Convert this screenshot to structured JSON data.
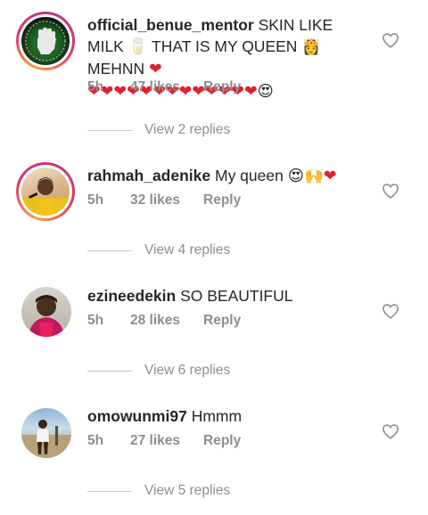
{
  "comments": [
    {
      "username": "official_benue_mentor",
      "text_part1": " SKIN LIKE MILK ",
      "milk_emoji": "🥛",
      "text_part2": " THAT IS MY QUEEN ",
      "queen_emoji": "👸",
      "text_part3": " MEHNN ",
      "hearts_line1": "❤",
      "hearts_line2": "❤❤❤❤❤❤❤❤❤❤❤❤❤",
      "heart_eyes": "😍",
      "time": "5h",
      "likes": "47 likes",
      "reply_label": "Reply",
      "view_replies": "View 2 replies"
    },
    {
      "username": "rahmah_adenike",
      "text": " My queen ",
      "emojis": "😍🙌",
      "heart": "❤",
      "time": "5h",
      "likes": "32 likes",
      "reply_label": "Reply",
      "view_replies": "View 4 replies"
    },
    {
      "username": "ezineedekin",
      "text": " SO BEAUTIFUL",
      "time": "5h",
      "likes": "28 likes",
      "reply_label": "Reply",
      "view_replies": "View 6 replies"
    },
    {
      "username": "omowunmi97",
      "text": " Hmmm",
      "time": "5h",
      "likes": "27 likes",
      "reply_label": "Reply",
      "view_replies": "View 5 replies"
    }
  ],
  "colors": {
    "meta_text": "#8e8e8e",
    "heart_red": "#e0202c",
    "story_ring_start": "#f9a03f",
    "story_ring_end": "#c13584"
  },
  "icons": {
    "like": "heart-outline-icon"
  }
}
